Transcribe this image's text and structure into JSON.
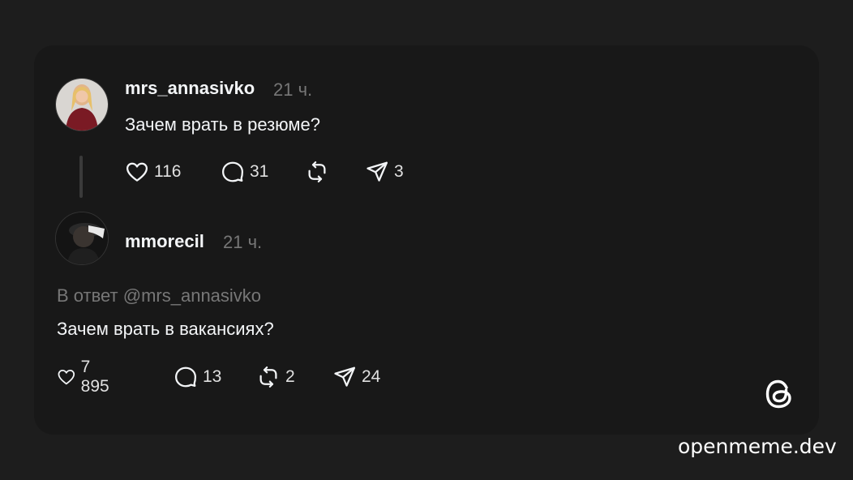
{
  "post": {
    "username": "mrs_annasivko",
    "time": "21 ч.",
    "text": "Зачем врать в резюме?",
    "likes": "116",
    "comments": "31",
    "shares": "3"
  },
  "reply": {
    "username": "mmorecil",
    "time": "21 ч.",
    "reply_to": "В ответ @mrs_annasivko",
    "text": "Зачем врать в вакансиях?",
    "likes": "7 895",
    "comments": "13",
    "reposts": "2",
    "shares": "24"
  },
  "icons": {
    "like": "heart-icon",
    "comment": "comment-bubble-icon",
    "repost": "repost-icon",
    "share": "share-send-icon",
    "logo": "threads-logo-icon"
  },
  "watermark": "openmeme.dev"
}
